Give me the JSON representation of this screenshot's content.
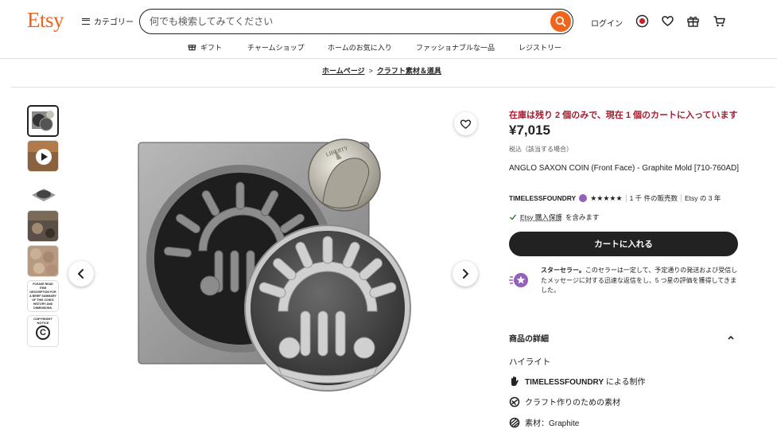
{
  "header": {
    "logo": "Etsy",
    "categories_label": "カテゴリー",
    "search_placeholder": "何でも検索してみてください",
    "login_label": "ログイン"
  },
  "subnav": [
    "ギフト",
    "チャームショップ",
    "ホームのお気に入り",
    "ファッショナブルな一品",
    "レジストリー"
  ],
  "breadcrumb": {
    "home": "ホームページ",
    "separator": ">",
    "category": "クラフト素材＆道具"
  },
  "thumbnails": {
    "notice_text": "PLEASE READ ITEM DESCRIPTION FOR A BRIEF SUMMARY OF THIS COIN'S HISTORY AND DIMENSIONS.",
    "copyright_text": "COPYRIGHT NOTICE"
  },
  "product": {
    "stock_alert": "在庫は残り 2 個のみで、現在 1 個のカートに入っています",
    "price": "¥7,015",
    "tax_note": "税込（該当する場合）",
    "title": "ANGLO SAXON COIN (Front Face) - Graphite Mold [710-760AD]",
    "coin_legend": "LIBERTY"
  },
  "shop": {
    "name": "TIMELESSFOUNDRY",
    "stars": "★★★★★",
    "sales": "1 千 件の販売数",
    "years": "Etsy の 3 年"
  },
  "protection": {
    "link": "Etsy 購入保護",
    "suffix": "を含みます"
  },
  "cart_button": "カートに入れる",
  "star_seller": {
    "title": "スターセラー。",
    "body": "このセラーは一定して、予定通りの発送および受信したメッセージに対する迅速な返信をし、5 つ星の評価を獲得してきました。"
  },
  "details": {
    "heading": "商品の詳細",
    "highlights_heading": "ハイライト",
    "items": [
      {
        "bold": "TIMELESSFOUNDRY",
        "text": " による制作"
      },
      {
        "bold": "",
        "text": "クラフト作りのための素材"
      },
      {
        "bold": "",
        "text": "素材：Graphite"
      }
    ]
  },
  "colors": {
    "brand": "#f1641e",
    "stock_red": "#a61a2e",
    "button_dark": "#222222",
    "star_seller": "#9560b8"
  }
}
